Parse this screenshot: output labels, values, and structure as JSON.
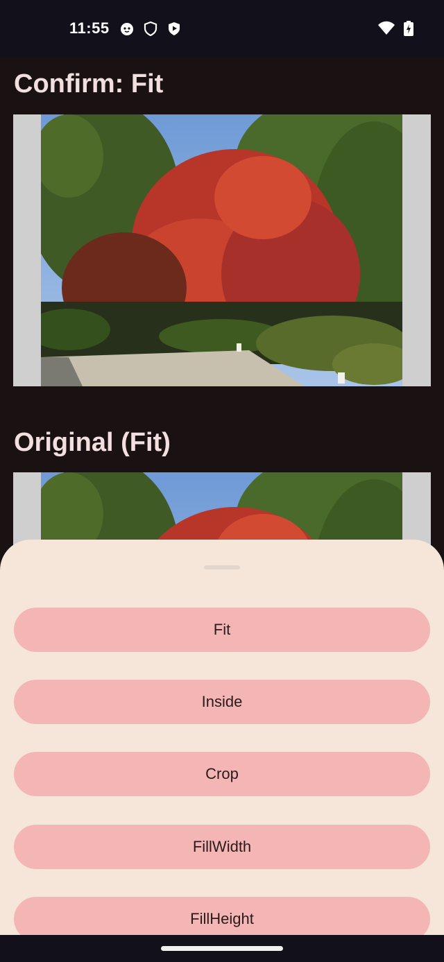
{
  "status_bar": {
    "time": "11:55",
    "left_icons": [
      "cat-face-icon",
      "shield-icon",
      "play-shield-icon"
    ],
    "right_icons": [
      "wifi-icon",
      "battery-charging-icon"
    ]
  },
  "sections": [
    {
      "title": "Confirm: Fit"
    },
    {
      "title": "Original (Fit)"
    }
  ],
  "sheet": {
    "options": [
      {
        "label": "Fit"
      },
      {
        "label": "Inside"
      },
      {
        "label": "Crop"
      },
      {
        "label": "FillWidth"
      },
      {
        "label": "FillHeight"
      }
    ]
  },
  "colors": {
    "background": "#1a1113",
    "sheet": "#f6e6da",
    "button": "#f4b6b4",
    "title": "#f2dfe0",
    "letterbox": "#cfcfcf"
  }
}
